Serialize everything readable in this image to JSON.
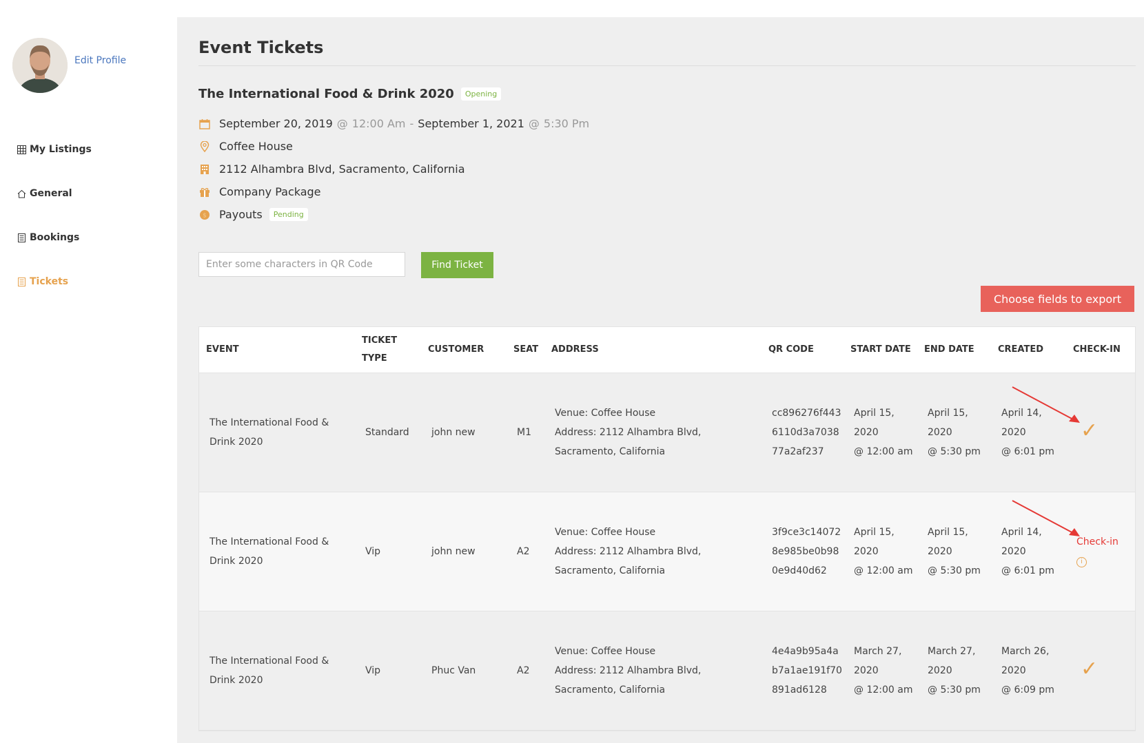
{
  "sidebar": {
    "edit_profile": "Edit Profile",
    "items": [
      {
        "label": "My Listings",
        "icon": "grid-icon"
      },
      {
        "label": "General",
        "icon": "home-icon"
      },
      {
        "label": "Bookings",
        "icon": "list-icon"
      },
      {
        "label": "Tickets",
        "icon": "ticket-icon",
        "active": true
      }
    ]
  },
  "main": {
    "title": "Event Tickets",
    "event": {
      "name": "The International Food & Drink 2020",
      "status": "Opening",
      "start_date": "September 20, 2019",
      "start_time": "12:00 Am",
      "end_date": "September 1, 2021",
      "end_time": "5:30 Pm",
      "at": "@",
      "dash": "-",
      "venue": "Coffee House",
      "address": "2112 Alhambra Blvd, Sacramento, California",
      "package": "Company Package",
      "payouts_label": "Payouts",
      "payouts_status": "Pending"
    },
    "search": {
      "placeholder": "Enter some characters in QR Code",
      "button": "Find Ticket"
    },
    "export_button": "Choose fields to export",
    "table": {
      "headers": [
        "EVENT",
        "TICKET TYPE",
        "CUSTOMER",
        "SEAT",
        "ADDRESS",
        "QR CODE",
        "START DATE",
        "END DATE",
        "CREATED",
        "CHECK-IN"
      ],
      "rows": [
        {
          "event": "The International Food & Drink 2020",
          "ticket_type": "Standard",
          "customer": "john new",
          "seat": "M1",
          "address_venue": "Venue: Coffee House",
          "address_line": "Address: 2112 Alhambra Blvd, Sacramento, California",
          "qr_code": "cc896276f4436110d3a703877a2af237",
          "start_date": "April 15, 2020",
          "start_time": "@ 12:00 am",
          "end_date": "April 15, 2020",
          "end_time": "@ 5:30 pm",
          "created_date": "April 14, 2020",
          "created_time": "@ 6:01 pm",
          "checked_in": true
        },
        {
          "event": "The International Food & Drink 2020",
          "ticket_type": "Vip",
          "customer": "john new",
          "seat": "A2",
          "address_venue": "Venue: Coffee House",
          "address_line": "Address: 2112 Alhambra Blvd, Sacramento, California",
          "qr_code": "3f9ce3c140728e985be0b980e9d40d62",
          "start_date": "April 15, 2020",
          "start_time": "@ 12:00 am",
          "end_date": "April 15, 2020",
          "end_time": "@ 5:30 pm",
          "created_date": "April 14, 2020",
          "created_time": "@ 6:01 pm",
          "checked_in": false,
          "checkin_label": "Check-in",
          "info_glyph": "i"
        },
        {
          "event": "The International Food & Drink 2020",
          "ticket_type": "Vip",
          "customer": "Phuc Van",
          "seat": "A2",
          "address_venue": "Venue: Coffee House",
          "address_line": "Address: 2112 Alhambra Blvd, Sacramento, California",
          "qr_code": "4e4a9b95a4ab7a1ae191f70891ad6128",
          "start_date": "March 27, 2020",
          "start_time": "@ 12:00 am",
          "end_date": "March 27, 2020",
          "end_time": "@ 5:30 pm",
          "created_date": "March 26, 2020",
          "created_time": "@ 6:09 pm",
          "checked_in": true
        }
      ]
    },
    "check_glyph": "✓"
  },
  "colors": {
    "accent": "#e6a24e",
    "green": "#7cb342",
    "red": "#e8625b",
    "link": "#4b77be"
  }
}
